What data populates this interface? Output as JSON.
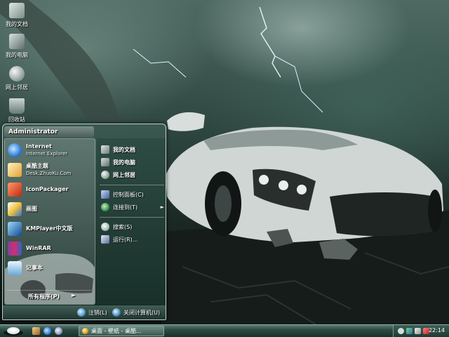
{
  "desktop": {
    "icons": [
      {
        "label": "我的文档",
        "icon": "my-documents-icon"
      },
      {
        "label": "我的电脑",
        "icon": "my-computer-icon"
      },
      {
        "label": "网上邻居",
        "icon": "network-places-icon"
      },
      {
        "label": "回收站",
        "icon": "recycle-bin-icon"
      }
    ]
  },
  "start_menu": {
    "user_name": "Administrator",
    "programs": [
      {
        "name": "Internet",
        "sub": "Internet Explorer",
        "icon": "internet-explorer-icon"
      },
      {
        "name": "桌酷主题",
        "sub": "Desk.ZhuoKu.Com",
        "icon": "zhuoku-theme-icon"
      },
      {
        "name": "IconPackager",
        "sub": "",
        "icon": "iconpackager-icon"
      },
      {
        "name": "画图",
        "sub": "",
        "icon": "paint-icon"
      },
      {
        "name": "KMPlayer中文版",
        "sub": "",
        "icon": "kmplayer-icon"
      },
      {
        "name": "WinRAR",
        "sub": "",
        "icon": "winrar-icon"
      },
      {
        "name": "记事本",
        "sub": "",
        "icon": "notepad-icon"
      }
    ],
    "all_programs": "所有程序(P)",
    "all_programs_arrow": "►",
    "places": [
      {
        "label": "我的文档",
        "icon": "my-documents-icon"
      },
      {
        "label": "我的电脑",
        "icon": "my-computer-icon"
      },
      {
        "label": "网上邻居",
        "icon": "network-places-icon"
      }
    ],
    "system": [
      {
        "label": "控制面板(C)",
        "icon": "control-panel-icon"
      },
      {
        "label": "连接到(T)",
        "icon": "connect-to-icon",
        "arrow": "►"
      },
      {
        "label": "搜索(S)",
        "icon": "search-icon"
      },
      {
        "label": "运行(R)...",
        "icon": "run-icon"
      }
    ],
    "logoff": "注销(L)",
    "shutdown": "关闭计算机(U)"
  },
  "taskbar": {
    "quick_launch": [
      "show-desktop-icon",
      "ie-quicklaunch-icon",
      "media-player-icon"
    ],
    "task_button": "桌面 - 壁纸 - 桌酷...",
    "clock": "22:14",
    "tray_icons": [
      "tray-arrow-icon",
      "tray-msn-icon",
      "tray-volume-icon",
      "tray-network-icon"
    ]
  },
  "colors": {
    "accent": "#2c4a42",
    "menu_border": "#bcd0c8",
    "highlight": "#86a69c"
  }
}
